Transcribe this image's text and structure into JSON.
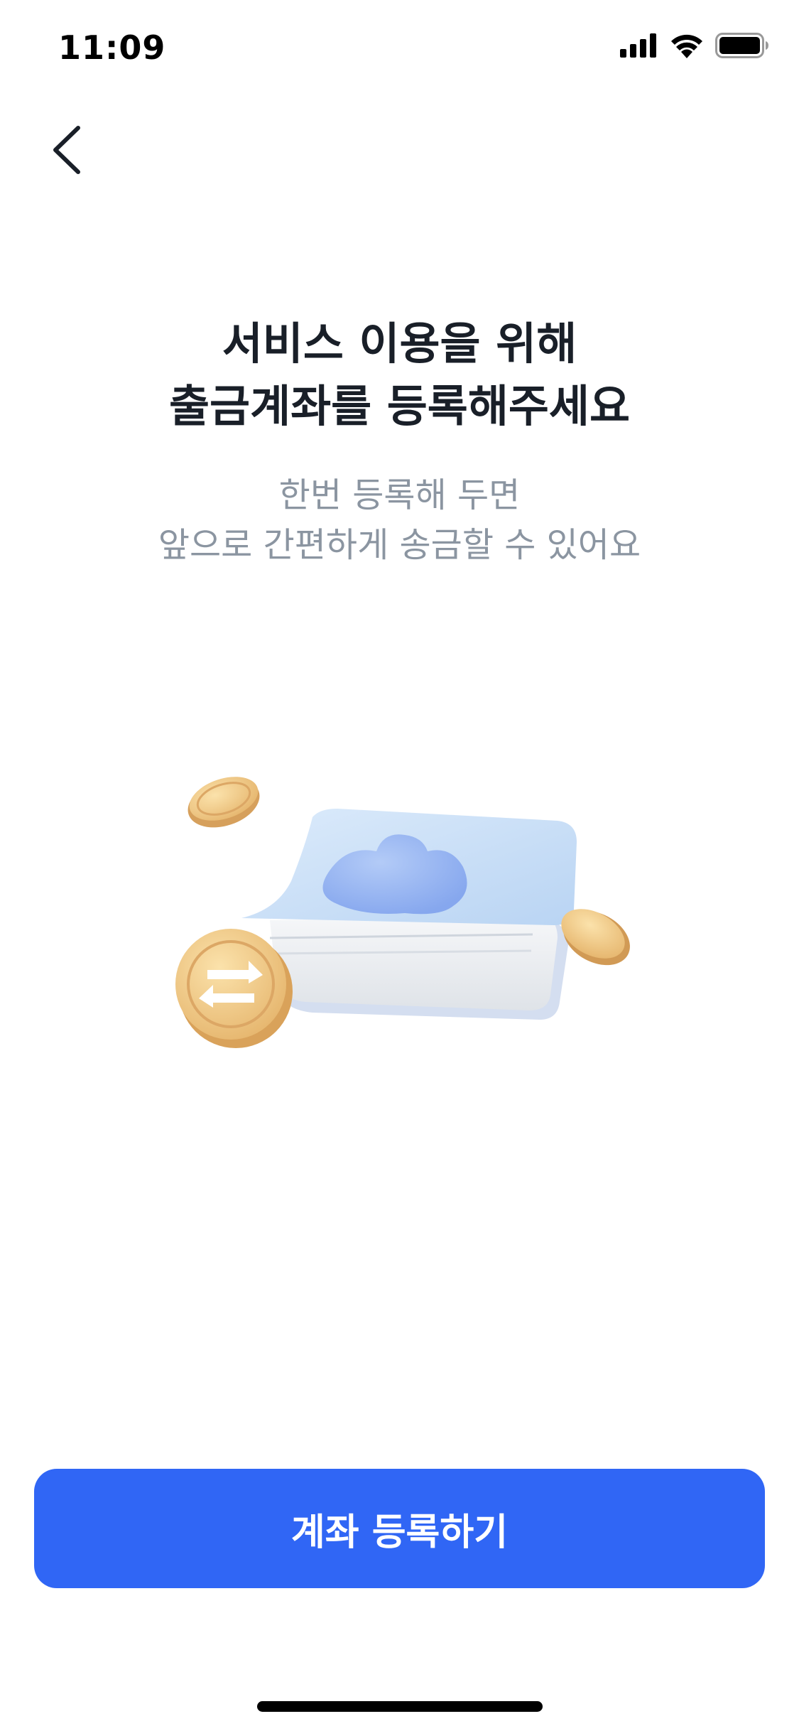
{
  "status_bar": {
    "time": "11:09",
    "icons": [
      "cellular-signal-icon",
      "wifi-icon",
      "battery-icon"
    ],
    "battery_level": 1.0
  },
  "nav": {
    "back_icon": "chevron-left-icon"
  },
  "header": {
    "title_line1": "서비스 이용을 위해",
    "title_line2": "출금계좌를 등록해주세요",
    "subtitle_line1": "한번 등록해 두면",
    "subtitle_line2": "앞으로 간편하게 송금할 수 있어요"
  },
  "illustration": {
    "name": "bankbook-with-coins-illustration",
    "colors": {
      "book_cover": "#cfe3f8",
      "book_pages": "#eef1f5",
      "blob": "#98b8f2",
      "coin": "#e9bd78",
      "coin_edge": "#d9a25a"
    }
  },
  "cta": {
    "label": "계좌 등록하기",
    "color": "#3066f5"
  }
}
